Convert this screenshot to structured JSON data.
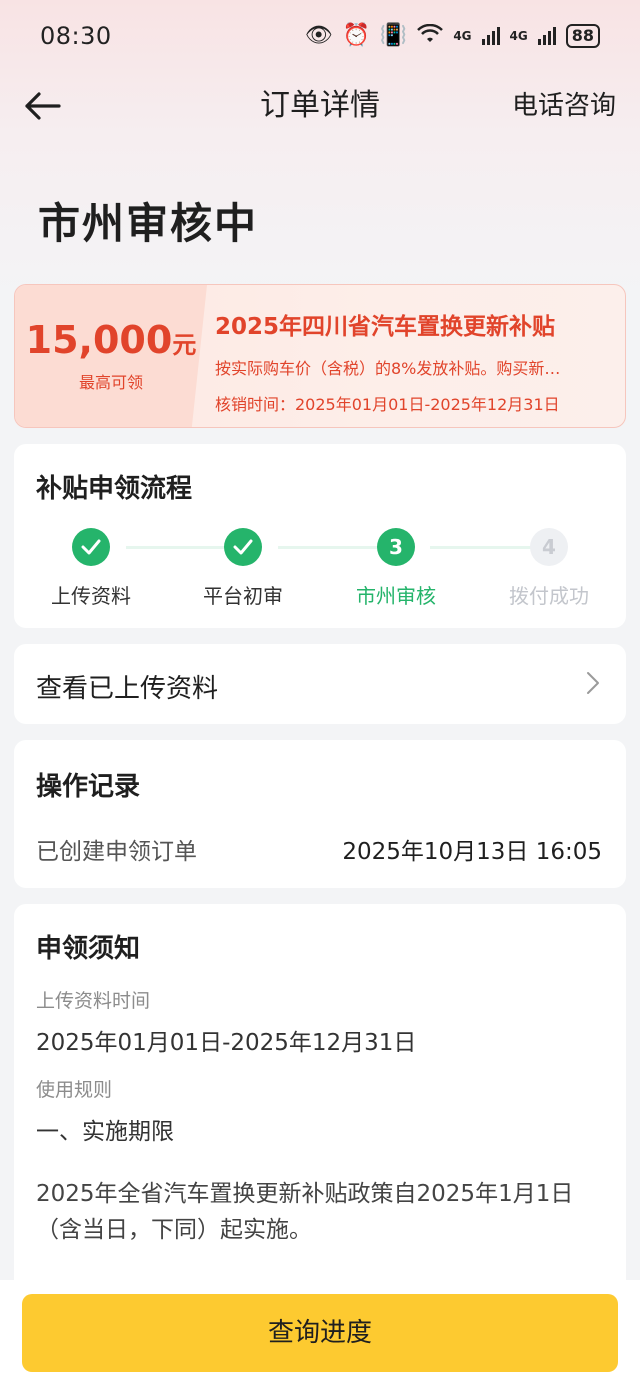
{
  "status_bar": {
    "time": "08:30",
    "signal_labels": [
      "4G",
      "4G"
    ],
    "battery": "88"
  },
  "nav": {
    "title": "订单详情",
    "right_action": "电话咨询"
  },
  "order_status": "市州审核中",
  "banner": {
    "amount": "15,000",
    "amount_unit": "元",
    "amount_sub": "最高可领",
    "title": "2025年四川省汽车置换更新补贴",
    "line1": "按实际购车价（含税）的8%发放补贴。购买新…",
    "line2": "核销时间：2025年01月01日-2025年12月31日"
  },
  "flow": {
    "title": "补贴申领流程",
    "steps": [
      {
        "label": "上传资料",
        "state": "done",
        "num": ""
      },
      {
        "label": "平台初审",
        "state": "done",
        "num": ""
      },
      {
        "label": "市州审核",
        "state": "current",
        "num": "3"
      },
      {
        "label": "拨付成功",
        "state": "pending",
        "num": "4"
      }
    ]
  },
  "uploaded_link": {
    "label": "查看已上传资料"
  },
  "records": {
    "title": "操作记录",
    "items": [
      {
        "label": "已创建申领订单",
        "time": "2025年10月13日 16:05"
      }
    ]
  },
  "notice": {
    "title": "申领须知",
    "upload_time_label": "上传资料时间",
    "upload_time_value": "2025年01月01日-2025年12月31日",
    "rules_label": "使用规则",
    "rules_heading": "一、实施期限",
    "rules_paragraph": "2025年全省汽车置换更新补贴政策自2025年1月1日（含当日，下同）起实施。"
  },
  "bottom": {
    "button_label": "查询进度"
  },
  "colors": {
    "accent_green": "#25b46b",
    "accent_red": "#e1442b",
    "button_yellow": "#fdca30"
  }
}
